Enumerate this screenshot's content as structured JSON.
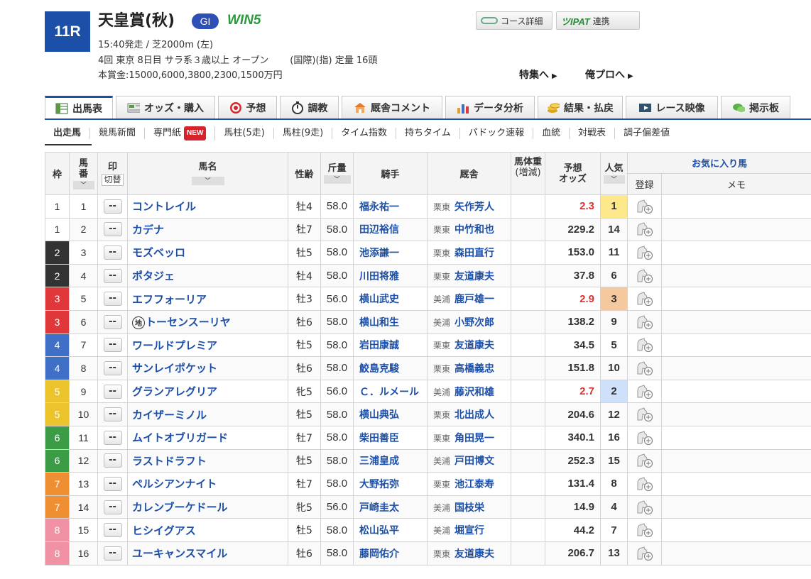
{
  "race": {
    "number": "11R",
    "title": "天皇賞(秋)",
    "grade": "GI",
    "win5": "WIN5",
    "line1": "15:40発走 / 芝2000m (左)",
    "line2a": "4回 東京 8日目 サラ系３歳以上 オープン",
    "line2b": "(国際)(指) 定量 16頭",
    "line3": "本賞金:15000,6000,3800,2300,1500万円"
  },
  "buttons": {
    "course": "コース詳細",
    "ipat_mark": "IPAT",
    "ipat": "連携"
  },
  "header_links": {
    "tokushu": "特集へ",
    "orepro": "俺プロへ"
  },
  "tabs": [
    {
      "label": "出馬表",
      "icon": "table-icon"
    },
    {
      "label": "オッズ・購入",
      "icon": "odds-icon"
    },
    {
      "label": "予想",
      "icon": "target-icon"
    },
    {
      "label": "調教",
      "icon": "stopwatch-icon"
    },
    {
      "label": "厩舎コメント",
      "icon": "stable-icon"
    },
    {
      "label": "データ分析",
      "icon": "bar-chart-icon"
    },
    {
      "label": "結果・払戻",
      "icon": "coins-icon"
    },
    {
      "label": "レース映像",
      "icon": "video-icon"
    },
    {
      "label": "掲示板",
      "icon": "chat-icon"
    }
  ],
  "subnav": [
    "出走馬",
    "競馬新聞",
    "専門紙",
    "馬柱(5走)",
    "馬柱(9走)",
    "タイム指数",
    "持ちタイム",
    "パドック速報",
    "血統",
    "対戦表",
    "調子偏差値"
  ],
  "new_badge": "NEW",
  "headers": {
    "waku": "枠",
    "umaban_1": "馬",
    "umaban_2": "番",
    "mark": "印",
    "kirikae": "切替",
    "name": "馬名",
    "sex": "性齢",
    "weight": "斤量",
    "jockey": "騎手",
    "stable": "厩舎",
    "body_1": "馬体重",
    "body_2": "(増減)",
    "odds_1": "予想",
    "odds_2": "オッズ",
    "pop": "人気",
    "fav": "お気に入り馬",
    "reg": "登録",
    "memo": "メモ",
    "sort_glyph": "﹀"
  },
  "mark_empty": "--",
  "chihou_mark": "地",
  "colors": {
    "waku_bg": {
      "1": "#ffffff",
      "2": "#333333",
      "3": "#e0373b",
      "4": "#3f6fc6",
      "5": "#ebc42b",
      "6": "#3c9b45",
      "7": "#f08f31",
      "8": "#f091a4"
    },
    "waku_fg": {
      "1": "#333333",
      "2": "#ffffff",
      "3": "#ffffff",
      "4": "#ffffff",
      "5": "#ffffff",
      "6": "#ffffff",
      "7": "#ffffff",
      "8": "#ffffff"
    },
    "pop_bg": {
      "1": "#fde98c",
      "2": "#cfe0fb",
      "3": "#f5c9a0"
    }
  },
  "horses": [
    {
      "waku": "1",
      "umaban": "1",
      "name": "コントレイル",
      "sex": "牡4",
      "weight": "58.0",
      "jockey": "福永祐一",
      "area": "栗東",
      "trainer": "矢作芳人",
      "odds": "2.3",
      "pop": "1"
    },
    {
      "waku": "1",
      "umaban": "2",
      "name": "カデナ",
      "sex": "牡7",
      "weight": "58.0",
      "jockey": "田辺裕信",
      "area": "栗東",
      "trainer": "中竹和也",
      "odds": "229.2",
      "pop": "14"
    },
    {
      "waku": "2",
      "umaban": "3",
      "name": "モズベッロ",
      "sex": "牡5",
      "weight": "58.0",
      "jockey": "池添謙一",
      "area": "栗東",
      "trainer": "森田直行",
      "odds": "153.0",
      "pop": "11"
    },
    {
      "waku": "2",
      "umaban": "4",
      "name": "ポタジェ",
      "sex": "牡4",
      "weight": "58.0",
      "jockey": "川田将雅",
      "area": "栗東",
      "trainer": "友道康夫",
      "odds": "37.8",
      "pop": "6"
    },
    {
      "waku": "3",
      "umaban": "5",
      "name": "エフフォーリア",
      "sex": "牡3",
      "weight": "56.0",
      "jockey": "横山武史",
      "area": "美浦",
      "trainer": "鹿戸雄一",
      "odds": "2.9",
      "pop": "3"
    },
    {
      "waku": "3",
      "umaban": "6",
      "name": "トーセンスーリヤ",
      "chihou": true,
      "sex": "牡6",
      "weight": "58.0",
      "jockey": "横山和生",
      "area": "美浦",
      "trainer": "小野次郎",
      "odds": "138.2",
      "pop": "9"
    },
    {
      "waku": "4",
      "umaban": "7",
      "name": "ワールドプレミア",
      "sex": "牡5",
      "weight": "58.0",
      "jockey": "岩田康誠",
      "area": "栗東",
      "trainer": "友道康夫",
      "odds": "34.5",
      "pop": "5"
    },
    {
      "waku": "4",
      "umaban": "8",
      "name": "サンレイポケット",
      "sex": "牡6",
      "weight": "58.0",
      "jockey": "鮫島克駿",
      "area": "栗東",
      "trainer": "高橋義忠",
      "odds": "151.8",
      "pop": "10"
    },
    {
      "waku": "5",
      "umaban": "9",
      "name": "グランアレグリア",
      "sex": "牝5",
      "weight": "56.0",
      "jockey": "Ｃ．ルメール",
      "area": "美浦",
      "trainer": "藤沢和雄",
      "odds": "2.7",
      "pop": "2"
    },
    {
      "waku": "5",
      "umaban": "10",
      "name": "カイザーミノル",
      "sex": "牡5",
      "weight": "58.0",
      "jockey": "横山典弘",
      "area": "栗東",
      "trainer": "北出成人",
      "odds": "204.6",
      "pop": "12"
    },
    {
      "waku": "6",
      "umaban": "11",
      "name": "ムイトオブリガード",
      "sex": "牡7",
      "weight": "58.0",
      "jockey": "柴田善臣",
      "area": "栗東",
      "trainer": "角田晃一",
      "odds": "340.1",
      "pop": "16"
    },
    {
      "waku": "6",
      "umaban": "12",
      "name": "ラストドラフト",
      "sex": "牡5",
      "weight": "58.0",
      "jockey": "三浦皇成",
      "area": "美浦",
      "trainer": "戸田博文",
      "odds": "252.3",
      "pop": "15"
    },
    {
      "waku": "7",
      "umaban": "13",
      "name": "ペルシアンナイト",
      "sex": "牡7",
      "weight": "58.0",
      "jockey": "大野拓弥",
      "area": "栗東",
      "trainer": "池江泰寿",
      "odds": "131.4",
      "pop": "8"
    },
    {
      "waku": "7",
      "umaban": "14",
      "name": "カレンブーケドール",
      "sex": "牝5",
      "weight": "56.0",
      "jockey": "戸崎圭太",
      "area": "美浦",
      "trainer": "国枝栄",
      "odds": "14.9",
      "pop": "4"
    },
    {
      "waku": "8",
      "umaban": "15",
      "name": "ヒシイグアス",
      "sex": "牡5",
      "weight": "58.0",
      "jockey": "松山弘平",
      "area": "美浦",
      "trainer": "堀宣行",
      "odds": "44.2",
      "pop": "7"
    },
    {
      "waku": "8",
      "umaban": "16",
      "name": "ユーキャンスマイル",
      "sex": "牡6",
      "weight": "58.0",
      "jockey": "藤岡佑介",
      "area": "栗東",
      "trainer": "友道康夫",
      "odds": "206.7",
      "pop": "13"
    }
  ]
}
